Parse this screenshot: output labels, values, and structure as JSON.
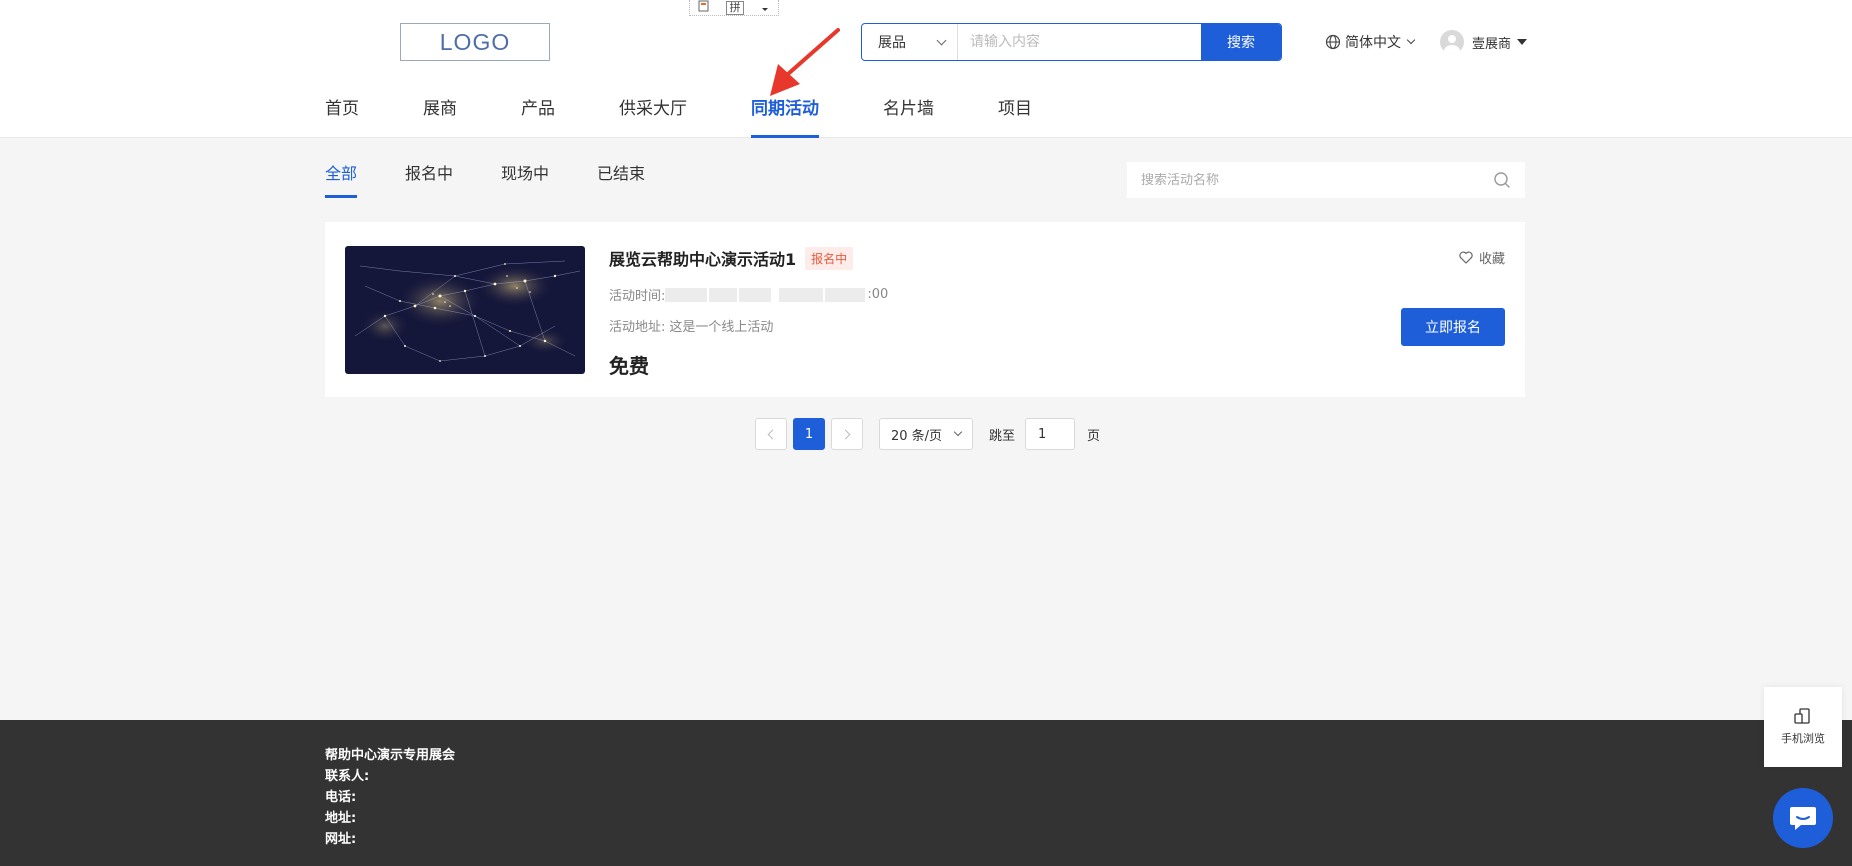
{
  "ime_toolbar": {
    "glyph": "拼"
  },
  "header": {
    "logo": "LOGO",
    "search": {
      "type": "展品",
      "placeholder": "请输入内容",
      "button": "搜索"
    },
    "language": "简体中文",
    "user": "壹展商"
  },
  "nav": {
    "items": [
      {
        "label": "首页"
      },
      {
        "label": "展商"
      },
      {
        "label": "产品"
      },
      {
        "label": "供采大厅"
      },
      {
        "label": "同期活动",
        "active": true
      },
      {
        "label": "名片墙"
      },
      {
        "label": "项目"
      }
    ]
  },
  "sub_tabs": [
    "全部",
    "报名中",
    "现场中",
    "已结束"
  ],
  "activity_search": {
    "placeholder": "搜索活动名称"
  },
  "card": {
    "title": "展览云帮助中心演示活动1",
    "status": "报名中",
    "time_label": "活动时间:",
    "time_suffix": ":00",
    "address_label": "活动地址:",
    "address": "这是一个线上活动",
    "price": "免费",
    "favorite": "收藏",
    "signup": "立即报名"
  },
  "pagination": {
    "current": "1",
    "page_size": "20 条/页",
    "jump_label": "跳至",
    "jump_value": "1",
    "page_label": "页"
  },
  "footer": {
    "lines": [
      "帮助中心演示专用展会",
      "联系人:",
      "电话:",
      "地址:",
      "网址:"
    ]
  },
  "floating": {
    "mobile_view": "手机浏览"
  },
  "colors": {
    "primary": "#1e5fd9",
    "status": "#e85a3c",
    "footer_bg": "#333333",
    "annotation": "#e8382b"
  }
}
